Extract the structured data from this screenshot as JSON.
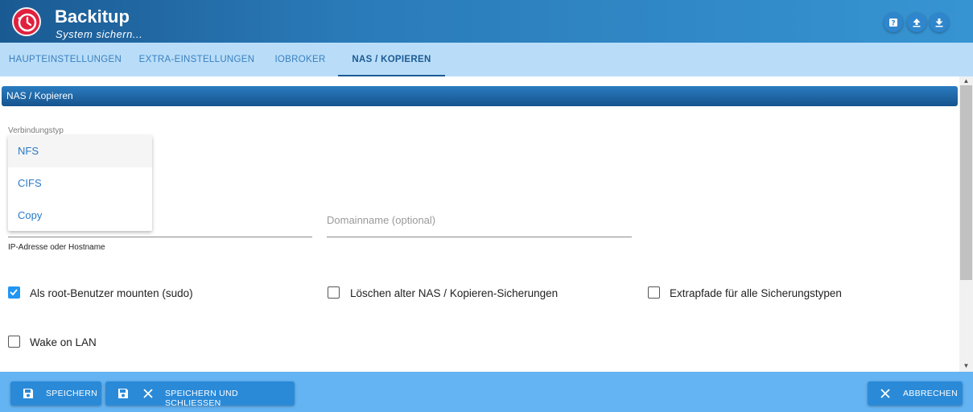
{
  "app": {
    "title": "Backitup",
    "subtitle": "System sichern..."
  },
  "header_buttons": [
    "help-icon",
    "upload-icon",
    "download-icon"
  ],
  "tabs": [
    {
      "label": "HAUPTEINSTELLUNGEN"
    },
    {
      "label": "EXTRA-EINSTELLUNGEN"
    },
    {
      "label": "IOBROKER"
    },
    {
      "label": "NAS / KOPIEREN",
      "active": true
    }
  ],
  "section": {
    "title": "NAS / Kopieren"
  },
  "connection": {
    "label": "Verbindungstyp",
    "options": [
      "NFS",
      "CIFS",
      "Copy"
    ],
    "highlighted": "NFS"
  },
  "fields": {
    "host_helper": "IP-Adresse oder Hostname",
    "domain_placeholder": "Domainname (optional)"
  },
  "checkboxes": {
    "sudo": {
      "label": "Als root-Benutzer mounten (sudo)",
      "checked": true
    },
    "delete_old": {
      "label": "Löschen alter NAS / Kopieren-Sicherungen",
      "checked": false
    },
    "extra_paths": {
      "label": "Extrapfade für alle Sicherungstypen",
      "checked": false
    },
    "wol": {
      "label": "Wake on LAN",
      "checked": false
    }
  },
  "footer": {
    "save": "SPEICHERN",
    "save_close": "SPEICHERN UND SCHLIESSEN",
    "cancel": "ABBRECHEN"
  },
  "colors": {
    "header": "#2a7ab8",
    "tabs_bg": "#b9ddf8",
    "footer": "#64b3f2",
    "button": "#2a8ad8",
    "checkbox": "#2196f3",
    "logo": "#e0203e"
  }
}
